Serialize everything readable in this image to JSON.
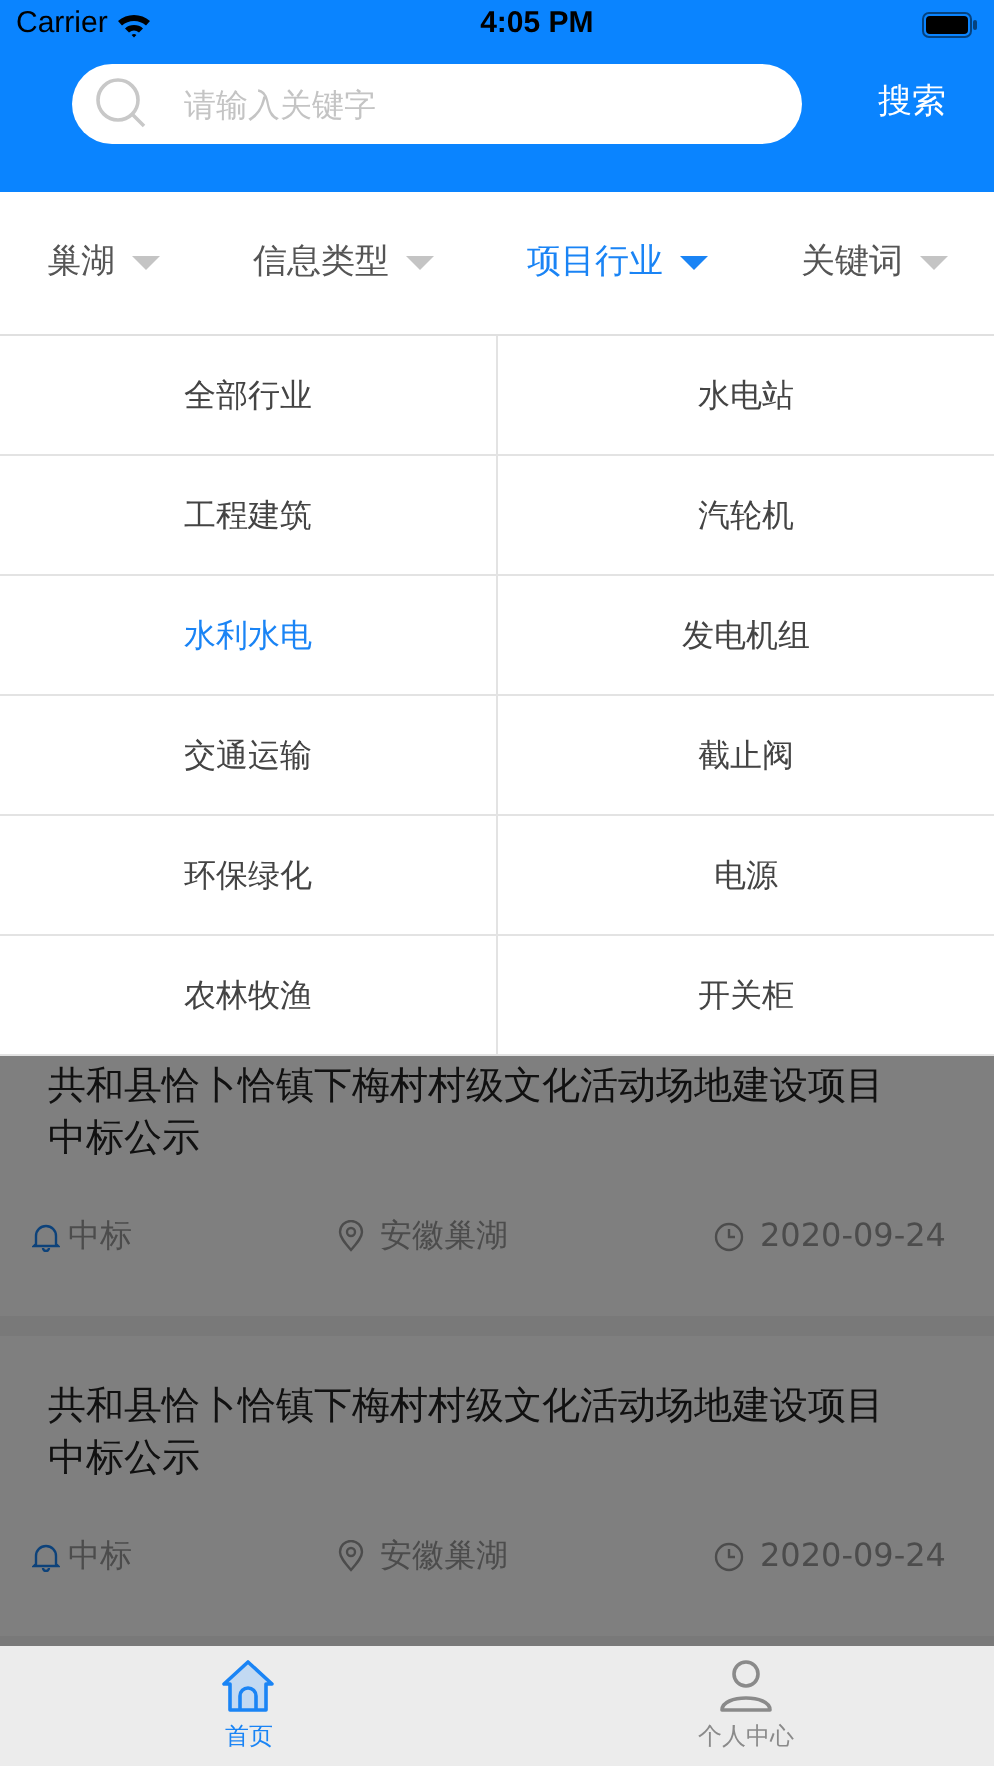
{
  "status_bar": {
    "carrier": "Carrier",
    "time": "4:05 PM"
  },
  "search": {
    "placeholder": "请输入关键字",
    "button": "搜索"
  },
  "filters": [
    {
      "label": "巢湖",
      "selected": false
    },
    {
      "label": "信息类型",
      "selected": false
    },
    {
      "label": "项目行业",
      "selected": true
    },
    {
      "label": "关键词",
      "selected": false
    }
  ],
  "dropdown_options": [
    {
      "label": "全部行业",
      "selected": false
    },
    {
      "label": "水电站",
      "selected": false
    },
    {
      "label": "工程建筑",
      "selected": false
    },
    {
      "label": "汽轮机",
      "selected": false
    },
    {
      "label": "水利水电",
      "selected": true
    },
    {
      "label": "发电机组",
      "selected": false
    },
    {
      "label": "交通运输",
      "selected": false
    },
    {
      "label": "截止阀",
      "selected": false
    },
    {
      "label": "环保绿化",
      "selected": false
    },
    {
      "label": "电源",
      "selected": false
    },
    {
      "label": "农林牧渔",
      "selected": false
    },
    {
      "label": "开关柜",
      "selected": false
    }
  ],
  "listings": [
    {
      "title": "共和县恰卜恰镇下梅村村级文化活动场地建设项目中标公示",
      "type": "中标",
      "location": "安徽巢湖",
      "date": "2020-09-24"
    },
    {
      "title": "共和县恰卜恰镇下梅村村级文化活动场地建设项目中标公示",
      "type": "中标",
      "location": "安徽巢湖",
      "date": "2020-09-24"
    }
  ],
  "tab_bar": [
    {
      "label": "首页",
      "selected": true,
      "kind": "home"
    },
    {
      "label": "个人中心",
      "selected": false,
      "kind": "profile"
    }
  ]
}
